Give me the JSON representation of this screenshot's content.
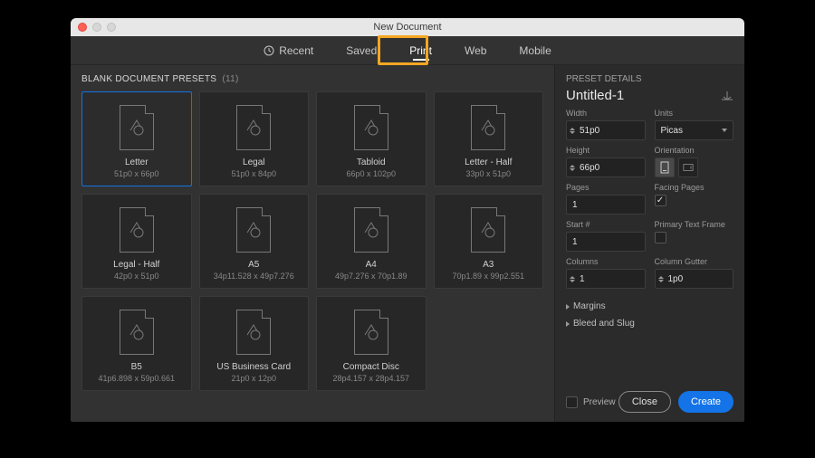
{
  "window": {
    "title": "New Document"
  },
  "tabs": {
    "recent": "Recent",
    "saved": "Saved",
    "print": "Print",
    "web": "Web",
    "mobile": "Mobile",
    "active": "print"
  },
  "section": {
    "title": "BLANK DOCUMENT PRESETS",
    "count": "(11)"
  },
  "presets": [
    {
      "name": "Letter",
      "dims": "51p0 x 66p0",
      "selected": true
    },
    {
      "name": "Legal",
      "dims": "51p0 x 84p0",
      "selected": false
    },
    {
      "name": "Tabloid",
      "dims": "66p0 x 102p0",
      "selected": false
    },
    {
      "name": "Letter - Half",
      "dims": "33p0 x 51p0",
      "selected": false
    },
    {
      "name": "Legal - Half",
      "dims": "42p0 x 51p0",
      "selected": false
    },
    {
      "name": "A5",
      "dims": "34p11.528 x 49p7.276",
      "selected": false
    },
    {
      "name": "A4",
      "dims": "49p7.276 x 70p1.89",
      "selected": false
    },
    {
      "name": "A3",
      "dims": "70p1.89 x 99p2.551",
      "selected": false
    },
    {
      "name": "B5",
      "dims": "41p6.898 x 59p0.661",
      "selected": false
    },
    {
      "name": "US Business Card",
      "dims": "21p0 x 12p0",
      "selected": false
    },
    {
      "name": "Compact Disc",
      "dims": "28p4.157 x 28p4.157",
      "selected": false
    }
  ],
  "details": {
    "header": "PRESET DETAILS",
    "docname": "Untitled-1",
    "labels": {
      "width": "Width",
      "units": "Units",
      "height": "Height",
      "orientation": "Orientation",
      "pages": "Pages",
      "facing": "Facing Pages",
      "start": "Start #",
      "ptf": "Primary Text Frame",
      "columns": "Columns",
      "gutter": "Column Gutter",
      "margins": "Margins",
      "bleed": "Bleed and Slug"
    },
    "values": {
      "width": "51p0",
      "height": "66p0",
      "units": "Picas",
      "pages": "1",
      "start": "1",
      "columns": "1",
      "gutter": "1p0",
      "facing_checked": true,
      "ptf_checked": false,
      "orientation": "portrait"
    }
  },
  "footer": {
    "preview": "Preview",
    "close": "Close",
    "create": "Create"
  }
}
